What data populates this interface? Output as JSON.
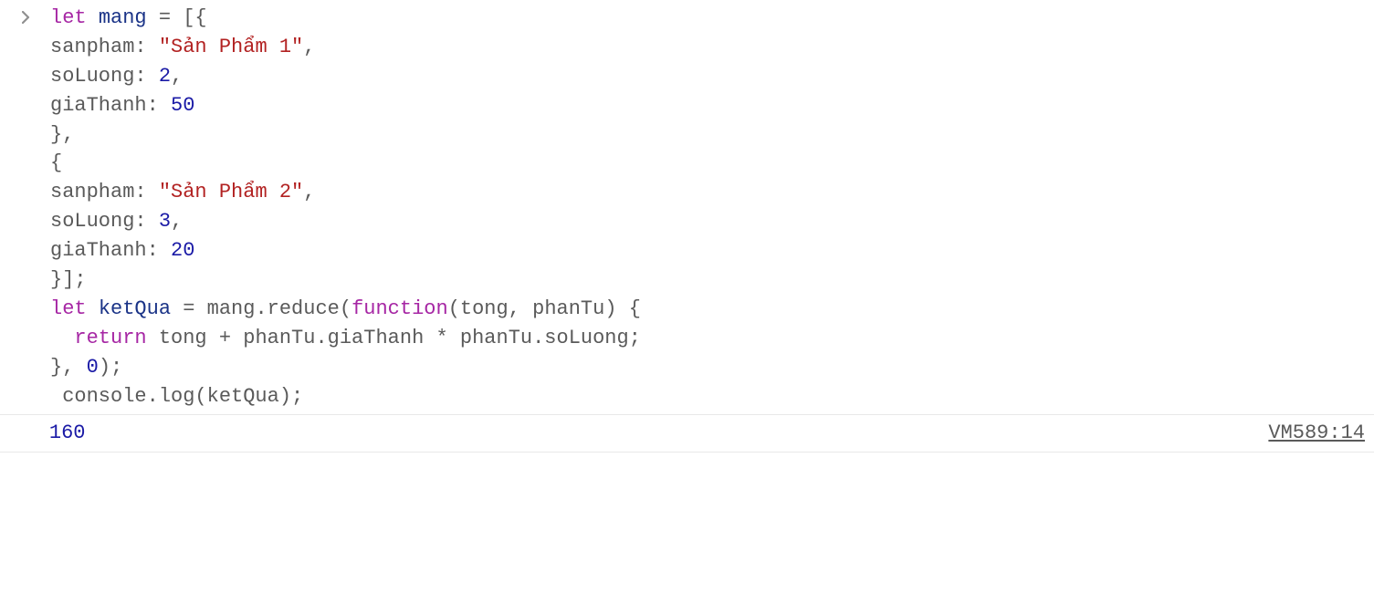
{
  "input": {
    "tokens": [
      {
        "cls": "tok-keyword",
        "text": "let"
      },
      {
        "cls": "tok-default",
        "text": " "
      },
      {
        "cls": "tok-declare",
        "text": "mang"
      },
      {
        "cls": "tok-default",
        "text": " = [{\n"
      },
      {
        "cls": "tok-default",
        "text": "sanpham: "
      },
      {
        "cls": "tok-string",
        "text": "\"Sản Phẩm 1\""
      },
      {
        "cls": "tok-default",
        "text": ",\n"
      },
      {
        "cls": "tok-default",
        "text": "soLuong: "
      },
      {
        "cls": "tok-number",
        "text": "2"
      },
      {
        "cls": "tok-default",
        "text": ",\n"
      },
      {
        "cls": "tok-default",
        "text": "giaThanh: "
      },
      {
        "cls": "tok-number",
        "text": "50"
      },
      {
        "cls": "tok-default",
        "text": "\n"
      },
      {
        "cls": "tok-default",
        "text": "},\n"
      },
      {
        "cls": "tok-default",
        "text": "{\n"
      },
      {
        "cls": "tok-default",
        "text": "sanpham: "
      },
      {
        "cls": "tok-string",
        "text": "\"Sản Phẩm 2\""
      },
      {
        "cls": "tok-default",
        "text": ",\n"
      },
      {
        "cls": "tok-default",
        "text": "soLuong: "
      },
      {
        "cls": "tok-number",
        "text": "3"
      },
      {
        "cls": "tok-default",
        "text": ",\n"
      },
      {
        "cls": "tok-default",
        "text": "giaThanh: "
      },
      {
        "cls": "tok-number",
        "text": "20"
      },
      {
        "cls": "tok-default",
        "text": "\n"
      },
      {
        "cls": "tok-default",
        "text": "}];\n"
      },
      {
        "cls": "tok-keyword",
        "text": "let"
      },
      {
        "cls": "tok-default",
        "text": " "
      },
      {
        "cls": "tok-declare",
        "text": "ketQua"
      },
      {
        "cls": "tok-default",
        "text": " = mang.reduce("
      },
      {
        "cls": "tok-function",
        "text": "function"
      },
      {
        "cls": "tok-default",
        "text": "(tong, phanTu) {\n"
      },
      {
        "cls": "tok-default",
        "text": "  "
      },
      {
        "cls": "tok-return",
        "text": "return"
      },
      {
        "cls": "tok-default",
        "text": " tong + phanTu.giaThanh * phanTu.soLuong;\n"
      },
      {
        "cls": "tok-default",
        "text": "}, "
      },
      {
        "cls": "tok-number",
        "text": "0"
      },
      {
        "cls": "tok-default",
        "text": ");\n"
      },
      {
        "cls": "tok-default",
        "text": " console.log(ketQua);"
      }
    ]
  },
  "output": {
    "value": "160",
    "source": "VM589:14"
  }
}
